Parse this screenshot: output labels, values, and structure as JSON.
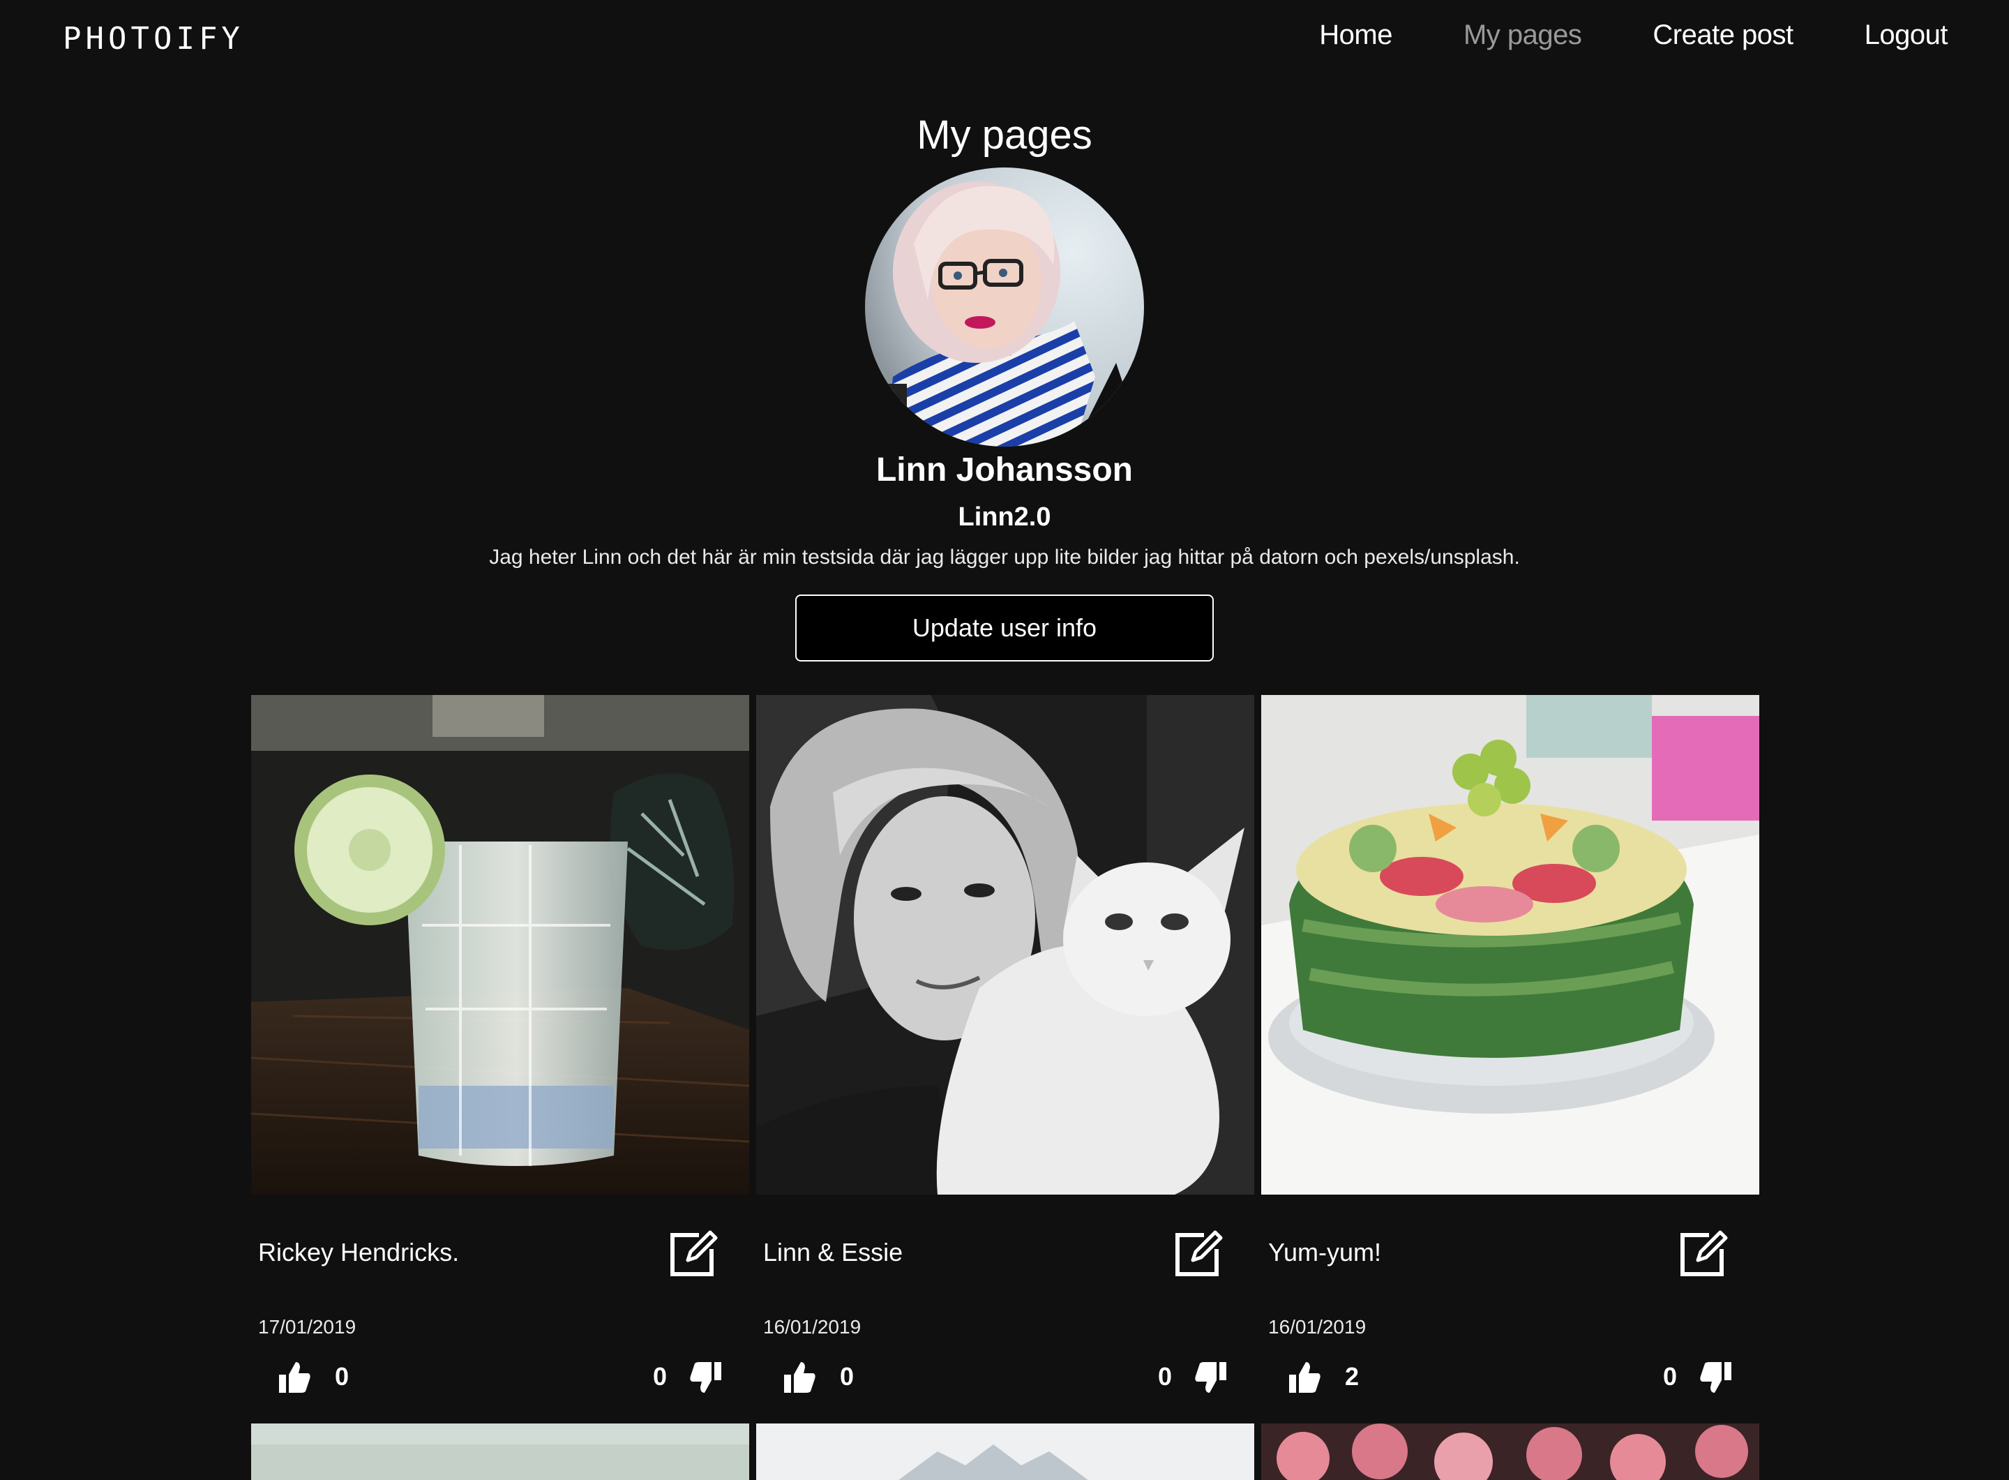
{
  "nav": {
    "logo": "PHOTOIFY",
    "links": [
      {
        "label": "Home",
        "active": false
      },
      {
        "label": "My pages",
        "active": true
      },
      {
        "label": "Create post",
        "active": false
      },
      {
        "label": "Logout",
        "active": false
      }
    ]
  },
  "profile": {
    "page_title": "My pages",
    "name": "Linn Johansson",
    "username": "Linn2.0",
    "bio": "Jag heter Linn och det här är min testsida där jag lägger upp lite bilder jag hittar på datorn och pexels/unsplash.",
    "update_button": "Update user info"
  },
  "posts": [
    {
      "title": "Rickey Hendricks.",
      "date": "17/01/2019",
      "likes": "0",
      "dislikes": "0",
      "image": "cocktail-photo"
    },
    {
      "title": "Linn & Essie",
      "date": "16/01/2019",
      "likes": "0",
      "dislikes": "0",
      "image": "woman-with-cat-photo"
    },
    {
      "title": "Yum-yum!",
      "date": "16/01/2019",
      "likes": "2",
      "dislikes": "0",
      "image": "sandwich-cake-photo"
    }
  ],
  "colors": {
    "background": "#101010",
    "text": "#ffffff",
    "nav_active": "#9a9a9a"
  }
}
